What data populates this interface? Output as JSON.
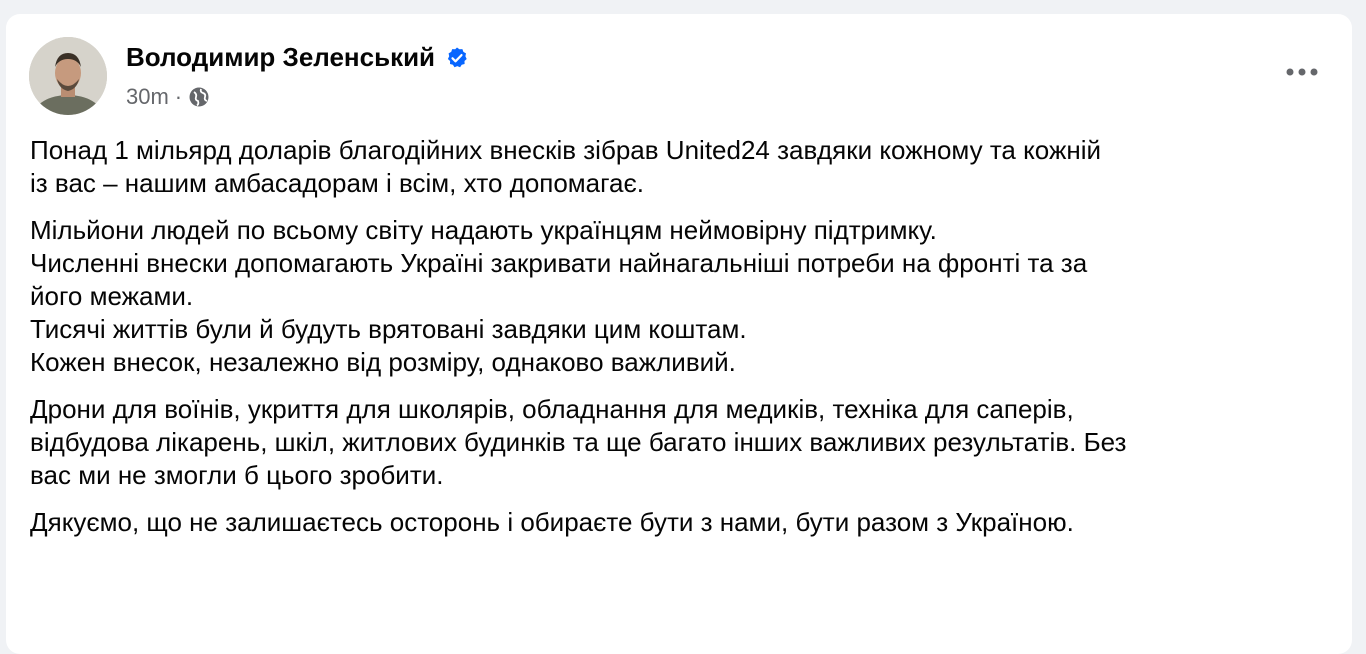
{
  "post": {
    "author": "Володимир Зеленський",
    "verified": true,
    "time": "30m",
    "separator": "·",
    "privacy_icon": "globe-icon",
    "more_icon": "more-options-icon",
    "paragraphs": [
      [
        "Понад 1 мільярд доларів благодійних внесків зібрав United24 завдяки кожному та кожній",
        "із вас – нашим амбасадорам і всім, хто допомагає."
      ],
      [
        "Мільйони людей по всьому світу надають українцям неймовірну підтримку.",
        "Численні внески допомагають Україні закривати найнагальніші потреби на фронті та за",
        "його межами.",
        "Тисячі життів були й будуть врятовані завдяки цим коштам.",
        "Кожен внесок, незалежно від розміру, однаково важливий."
      ],
      [
        "Дрони для воїнів, укриття для школярів, обладнання для медиків, техніка для саперів,",
        "відбудова лікарень, шкіл, житлових будинків та ще багато інших важливих результатів. Без",
        "вас ми не змогли б цього зробити."
      ],
      [
        "Дякуємо, що не залишаєтесь осторонь і обираєте бути з нами, бути разом з Україною."
      ]
    ]
  },
  "colors": {
    "verified_blue": "#0866ff",
    "meta_gray": "#65676b",
    "text": "#050505",
    "background": "#f0f2f5"
  }
}
